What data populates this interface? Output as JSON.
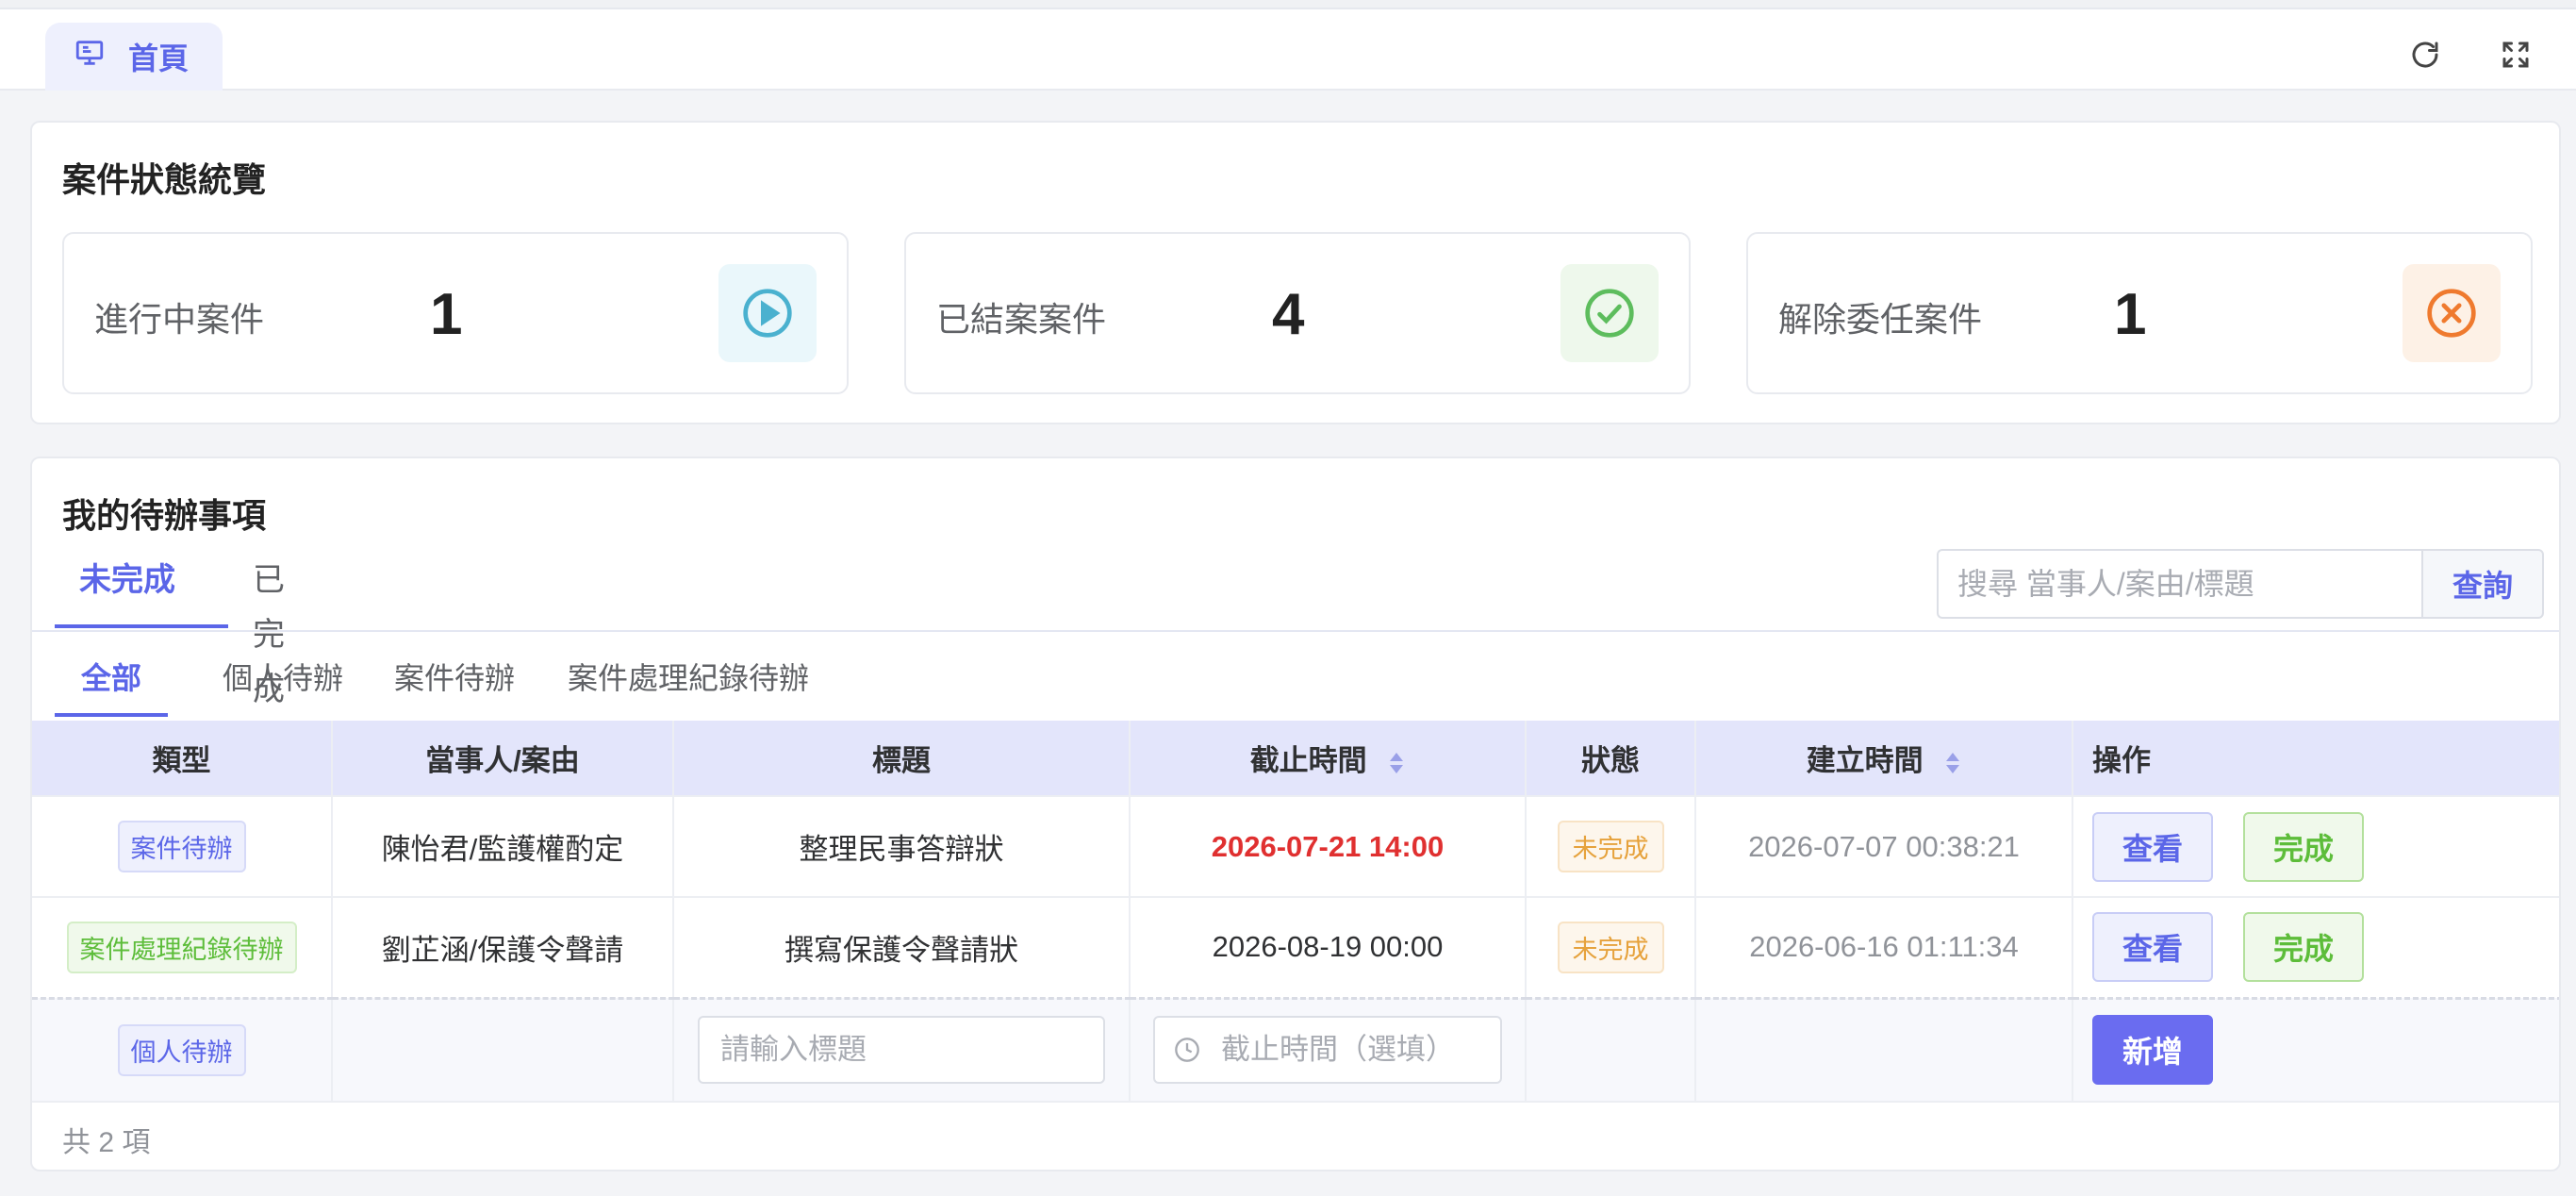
{
  "header": {
    "home_tab": "首頁",
    "refresh_icon": "refresh-icon",
    "fullscreen_icon": "fullscreen-icon"
  },
  "status_overview": {
    "title": "案件狀態統覽",
    "stats": [
      {
        "label": "進行中案件",
        "value": "1",
        "icon": "play-circle-icon",
        "color": "#4ab1cf",
        "bg": "#eaf7fb"
      },
      {
        "label": "已結案案件",
        "value": "4",
        "icon": "check-circle-icon",
        "color": "#5dbd5d",
        "bg": "#eef8ec"
      },
      {
        "label": "解除委任案件",
        "value": "1",
        "icon": "close-circle-icon",
        "color": "#ef7a2e",
        "bg": "#fdf1e6"
      }
    ]
  },
  "todo": {
    "title": "我的待辦事項",
    "tabs": [
      "未完成",
      "已完成"
    ],
    "active_tab": "未完成",
    "search_placeholder": "搜尋 當事人/案由/標題",
    "search_button": "查詢",
    "subtabs": [
      "全部",
      "個人待辦",
      "案件待辦",
      "案件處理紀錄待辦"
    ],
    "active_subtab": "全部",
    "columns": [
      "類型",
      "當事人/案由",
      "標題",
      "截止時間",
      "狀態",
      "建立時間",
      "操作"
    ],
    "rows": [
      {
        "type": "案件待辦",
        "party": "陳怡君/監護權酌定",
        "title": "整理民事答辯狀",
        "deadline": "2026-07-21 14:00",
        "status": "未完成",
        "created": "2026-07-07 00:38:21",
        "view": "查看",
        "done": "完成"
      },
      {
        "type": "案件處理紀錄待辦",
        "party": "劉芷涵/保護令聲請",
        "title": "撰寫保護令聲請狀",
        "deadline": "2026-08-19 00:00",
        "status": "未完成",
        "created": "2026-06-16 01:11:34",
        "view": "查看",
        "done": "完成"
      }
    ],
    "new_row": {
      "type": "個人待辦",
      "title_placeholder": "請輸入標題",
      "deadline_placeholder": "截止時間（選填）",
      "add_button": "新增"
    },
    "total": "共 2 項"
  }
}
